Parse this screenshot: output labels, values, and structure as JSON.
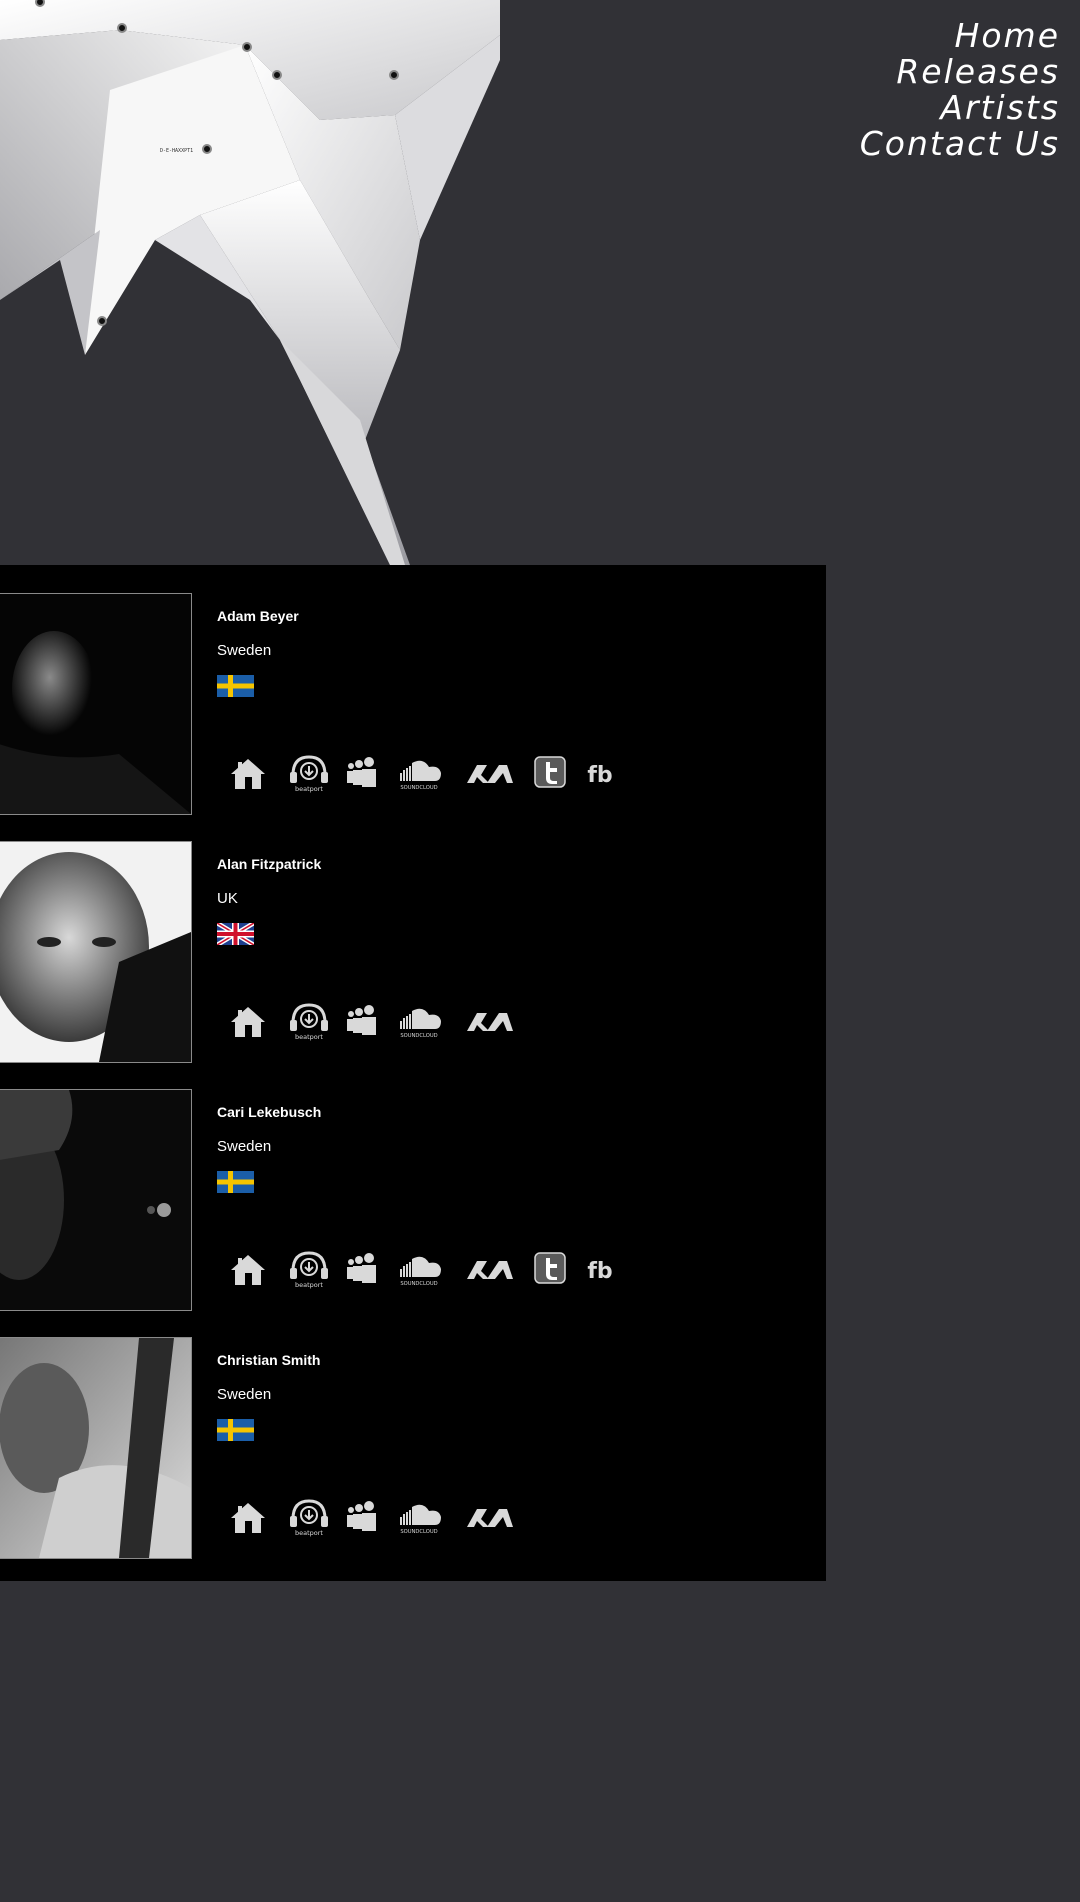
{
  "nav": {
    "items": [
      {
        "label": "Home"
      },
      {
        "label": "Releases"
      },
      {
        "label": "Artists"
      },
      {
        "label": "Contact Us"
      }
    ]
  },
  "logo": {
    "text": "D-E-HAXXPT1"
  },
  "artists": [
    {
      "name": "Adam Beyer",
      "country": "Sweden",
      "flag": "sweden",
      "links": [
        "home-icon",
        "beatport-icon",
        "myspace-icon",
        "soundcloud-icon",
        "resident-advisor-icon",
        "twitter-icon",
        "facebook-icon"
      ]
    },
    {
      "name": "Alan Fitzpatrick",
      "country": "UK",
      "flag": "uk",
      "links": [
        "home-icon",
        "beatport-icon",
        "myspace-icon",
        "soundcloud-icon",
        "resident-advisor-icon"
      ]
    },
    {
      "name": "Cari Lekebusch",
      "country": "Sweden",
      "flag": "sweden",
      "links": [
        "home-icon",
        "beatport-icon",
        "myspace-icon",
        "soundcloud-icon",
        "resident-advisor-icon",
        "twitter-icon",
        "facebook-icon"
      ]
    },
    {
      "name": "Christian Smith",
      "country": "Sweden",
      "flag": "sweden",
      "links": [
        "home-icon",
        "beatport-icon",
        "myspace-icon",
        "soundcloud-icon",
        "resident-advisor-icon"
      ]
    }
  ],
  "icon_labels": {
    "beatport": "beatport",
    "soundcloud": "SOUNDCLOUD",
    "facebook": "fb"
  },
  "colors": {
    "background": "#313136",
    "panel": "#000000",
    "text": "#ffffff",
    "icon": "#d9d9d9",
    "sweden_blue": "#1b5ea8",
    "sweden_yellow": "#f5c400",
    "uk_blue": "#1e3f8e",
    "uk_red": "#d0102c"
  }
}
